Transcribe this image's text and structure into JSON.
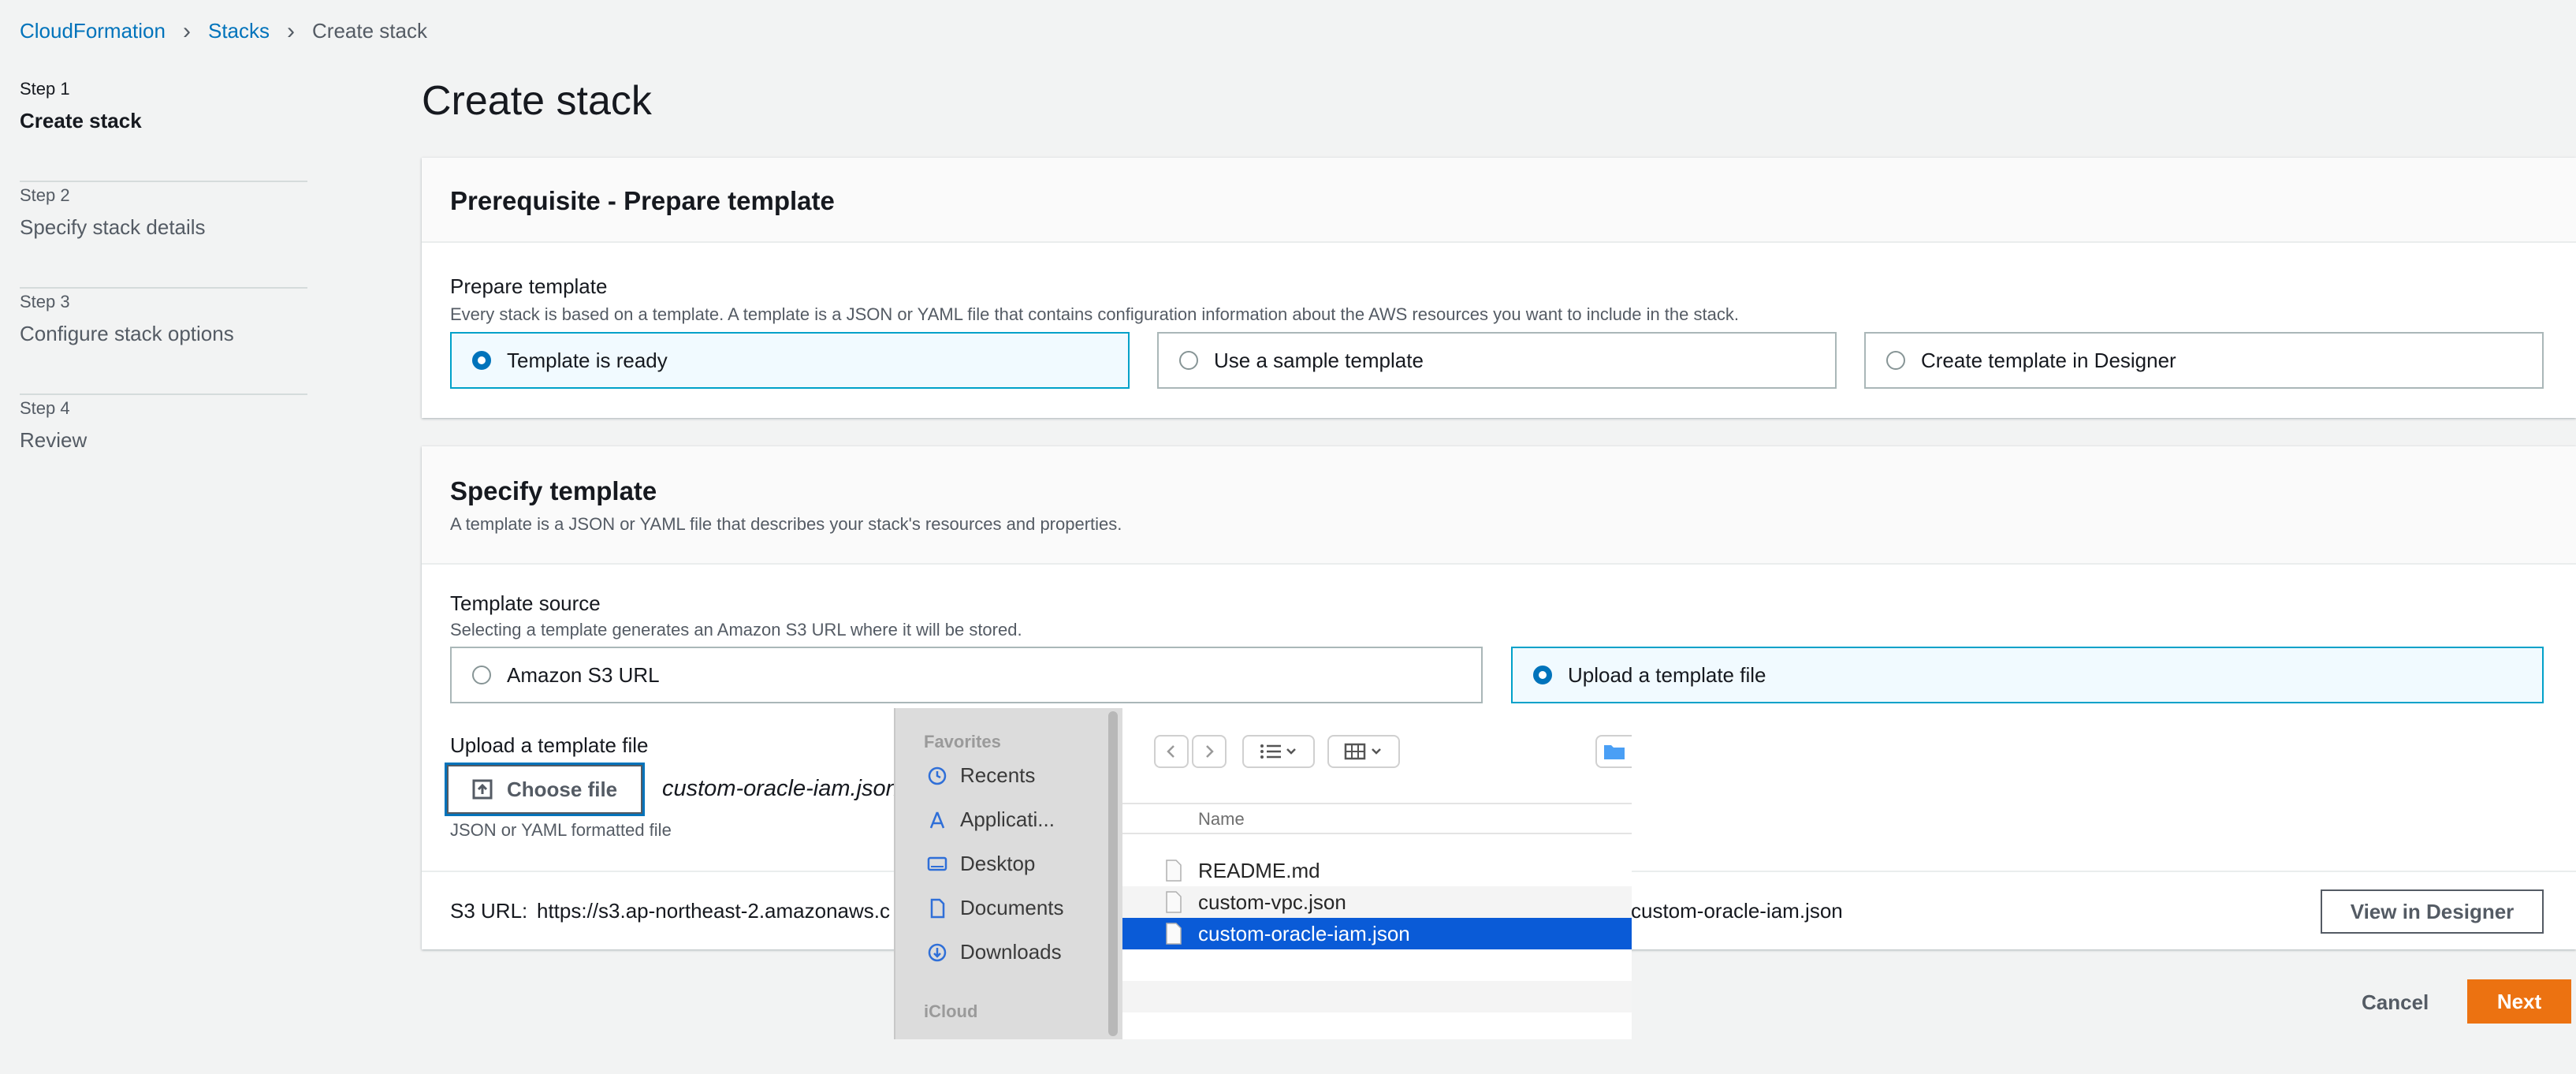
{
  "breadcrumb": {
    "root": "CloudFormation",
    "stacks": "Stacks",
    "current": "Create stack"
  },
  "steps": [
    {
      "num": "Step 1",
      "title": "Create stack"
    },
    {
      "num": "Step 2",
      "title": "Specify stack details"
    },
    {
      "num": "Step 3",
      "title": "Configure stack options"
    },
    {
      "num": "Step 4",
      "title": "Review"
    }
  ],
  "page_title": "Create stack",
  "prereq": {
    "title": "Prerequisite - Prepare template",
    "label": "Prepare template",
    "desc": "Every stack is based on a template. A template is a JSON or YAML file that contains configuration information about the AWS resources you want to include in the stack.",
    "options": [
      "Template is ready",
      "Use a sample template",
      "Create template in Designer"
    ],
    "selected": "Template is ready"
  },
  "specify": {
    "title": "Specify template",
    "desc": "A template is a JSON or YAML file that describes your stack's resources and properties.",
    "source_label": "Template source",
    "source_desc": "Selecting a template generates an Amazon S3 URL where it will be stored.",
    "source_options": [
      "Amazon S3 URL",
      "Upload a template file"
    ],
    "selected_source": "Upload a template file",
    "upload_label": "Upload a template file",
    "choose_file": "Choose file",
    "chosen_file": "custom-oracle-iam.json",
    "upload_hint": "JSON or YAML formatted file",
    "s3_label": "S3 URL:",
    "s3_url_start": "https://s3.ap-northeast-2.amazonaws.c",
    "s3_url_end": "custom-oracle-iam.json",
    "view_designer": "View in Designer"
  },
  "footer": {
    "cancel": "Cancel",
    "next": "Next"
  },
  "file_dialog": {
    "favorites_heading": "Favorites",
    "favorites": [
      "Recents",
      "Applicati...",
      "Desktop",
      "Documents",
      "Downloads"
    ],
    "icloud_heading": "iCloud",
    "column_name": "Name",
    "files": [
      "README.md",
      "custom-vpc.json",
      "custom-oracle-iam.json"
    ],
    "selected_file": "custom-oracle-iam.json"
  },
  "colors": {
    "link": "#0073bb",
    "primary": "#ec7211",
    "selection": "#0a5bd7"
  }
}
